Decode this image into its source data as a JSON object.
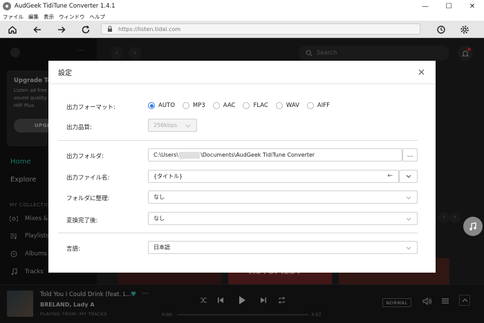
{
  "window": {
    "title": "AudGeek TidiTune Converter 1.4.1"
  },
  "menu": [
    "ファイル",
    "編集",
    "表示",
    "ウィンドウ",
    "ヘルプ"
  ],
  "toolbar": {
    "url": "https://listen.tidal.com"
  },
  "sidebar": {
    "upgrade_title": "Upgrade Too",
    "upgrade_text": [
      "Listen ad free",
      "sound quality",
      "HiFi Plus"
    ],
    "upgrade_button": "UPGR",
    "nav_home": "Home",
    "nav_explore": "Explore",
    "section_label": "MY COLLECTIO",
    "items": [
      "Mixes &",
      "Playlists",
      "Albums",
      "Tracks"
    ]
  },
  "main": {
    "search_placeholder": "Search",
    "thumb_label": "AUTOPILOT"
  },
  "player": {
    "track_title": "Told You I Could Drink (feat. L...",
    "artist": "BRELAND, Lady A",
    "playing_from": "PLAYING FROM: MY TRACKS",
    "time_current": "0:00",
    "time_total": "3:57",
    "progress": 0.0,
    "quality": "NORMAL"
  },
  "dialog": {
    "title": "設定",
    "output_format_label": "出力フォーマット:",
    "formats": [
      {
        "label": "AUTO",
        "selected": true
      },
      {
        "label": "MP3",
        "selected": false
      },
      {
        "label": "AAC",
        "selected": false
      },
      {
        "label": "FLAC",
        "selected": false
      },
      {
        "label": "WAV",
        "selected": false
      },
      {
        "label": "AIFF",
        "selected": false
      }
    ],
    "quality_label": "出力品質:",
    "quality_value": "256kbps",
    "folder_label": "出力フォルダ:",
    "folder_prefix": "C:\\Users\\",
    "folder_suffix": "\\Documents\\AudGeek TidiTune Converter",
    "browse_button": "...",
    "filename_label": "出力ファイル名:",
    "filename_value": "{タイトル}",
    "organize_label": "フォルダに整理:",
    "organize_value": "なし",
    "after_convert_label": "変換完了後:",
    "after_convert_value": "なし",
    "language_label": "言語:",
    "language_value": "日本語"
  },
  "colors": {
    "accent": "#2b78e4",
    "home_active": "#36d1c4",
    "heart": "#36d1c4"
  }
}
